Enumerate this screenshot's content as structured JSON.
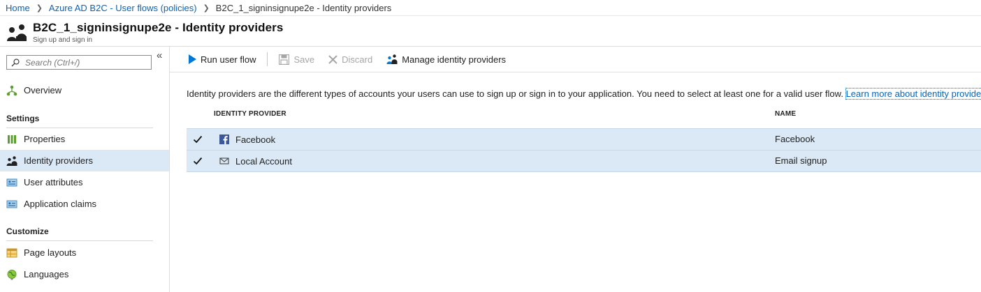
{
  "breadcrumb": {
    "home": "Home",
    "parent": "Azure AD B2C - User flows (policies)",
    "current": "B2C_1_signinsignupe2e - Identity providers"
  },
  "header": {
    "title": "B2C_1_signinsignupe2e - Identity providers",
    "subtitle": "Sign up and sign in"
  },
  "sidebar": {
    "collapse_glyph": "«",
    "search_placeholder": "Search (Ctrl+/)",
    "overview": "Overview",
    "settings_header": "Settings",
    "settings_items": [
      "Properties",
      "Identity providers",
      "User attributes",
      "Application claims"
    ],
    "customize_header": "Customize",
    "customize_items": [
      "Page layouts",
      "Languages"
    ],
    "selected": "Identity providers"
  },
  "toolbar": {
    "run": "Run user flow",
    "save": "Save",
    "discard": "Discard",
    "manage": "Manage identity providers"
  },
  "main": {
    "intro": "Identity providers are the different types of accounts your users can use to sign up or sign in to your application. You need to select at least one for a valid user flow.",
    "learn_more": "Learn more about identity providers.",
    "columns": {
      "provider": "IDENTITY PROVIDER",
      "name": "NAME"
    },
    "rows": [
      {
        "provider": "Facebook",
        "name": "Facebook",
        "checked": true,
        "icon": "facebook-icon"
      },
      {
        "provider": "Local Account",
        "name": "Email signup",
        "checked": true,
        "icon": "mail-icon"
      }
    ]
  },
  "colors": {
    "link": "#0b63b6",
    "selected_bg": "#dbe9f7",
    "accent_blue": "#0078d4",
    "facebook_blue": "#3b5998"
  }
}
